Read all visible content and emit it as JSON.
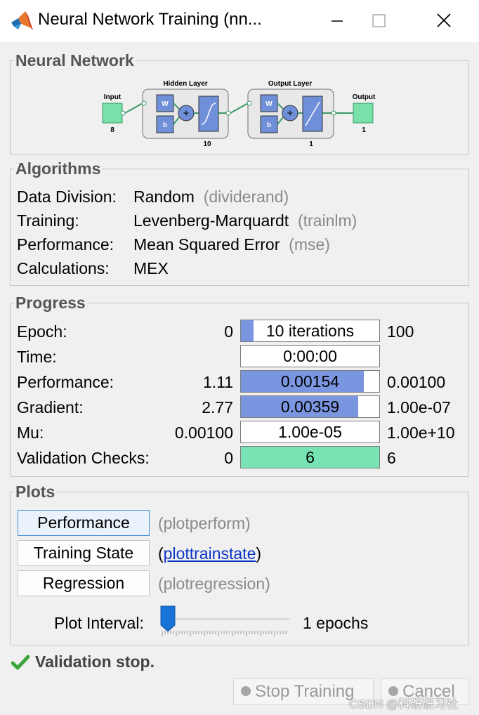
{
  "window": {
    "title": "Neural Network Training (nn...",
    "controls": {
      "minimize": "minimize-icon",
      "maximize": "maximize-icon",
      "close": "close-icon"
    }
  },
  "network": {
    "section_title": "Neural Network",
    "input_label": "Input",
    "input_size": "8",
    "hidden_layer": {
      "title": "Hidden Layer",
      "weight": "W",
      "bias": "b",
      "size": "10"
    },
    "output_layer": {
      "title": "Output Layer",
      "weight": "W",
      "bias": "b",
      "size": "1"
    },
    "output_label": "Output",
    "output_size": "1"
  },
  "algorithms": {
    "section_title": "Algorithms",
    "rows": [
      {
        "label": "Data Division:",
        "value": "Random",
        "fn": "(dividerand)"
      },
      {
        "label": "Training:",
        "value": "Levenberg-Marquardt",
        "fn": "(trainlm)"
      },
      {
        "label": "Performance:",
        "value": "Mean Squared Error",
        "fn": "(mse)"
      },
      {
        "label": "Calculations:",
        "value": "MEX",
        "fn": ""
      }
    ]
  },
  "progress": {
    "section_title": "Progress",
    "rows": [
      {
        "label": "Epoch:",
        "start": "0",
        "current": "10 iterations",
        "end": "100",
        "fill": 0.09,
        "color": "#7a96e0"
      },
      {
        "label": "Time:",
        "start": "",
        "current": "0:00:00",
        "end": "",
        "fill": 0,
        "color": "#7a96e0"
      },
      {
        "label": "Performance:",
        "start": "1.11",
        "current": "0.00154",
        "end": "0.00100",
        "fill": 0.89,
        "color": "#7a96e0"
      },
      {
        "label": "Gradient:",
        "start": "2.77",
        "current": "0.00359",
        "end": "1.00e-07",
        "fill": 0.85,
        "color": "#7a96e0"
      },
      {
        "label": "Mu:",
        "start": "0.00100",
        "current": "1.00e-05",
        "end": "1.00e+10",
        "fill": 0,
        "color": "#7a96e0"
      },
      {
        "label": "Validation Checks:",
        "start": "0",
        "current": "6",
        "end": "6",
        "fill": 1.0,
        "color": "#78e4b4"
      }
    ]
  },
  "plots": {
    "section_title": "Plots",
    "buttons": [
      {
        "label": "Performance",
        "fn": "(plotperform)"
      },
      {
        "label": "Training State",
        "fn_open": "(",
        "fn_link": "plottrainstate",
        "fn_close": ")"
      },
      {
        "label": "Regression",
        "fn": "(plotregression)"
      }
    ],
    "interval_label": "Plot Interval:",
    "interval_value": "1 epochs",
    "interval_level": 0.0
  },
  "status": {
    "icon": "checkmark-icon",
    "text": "Validation stop."
  },
  "footer": {
    "stop_label": "Stop Training",
    "cancel_label": "Cancel"
  },
  "watermark": "CSDN @科研研习社"
}
